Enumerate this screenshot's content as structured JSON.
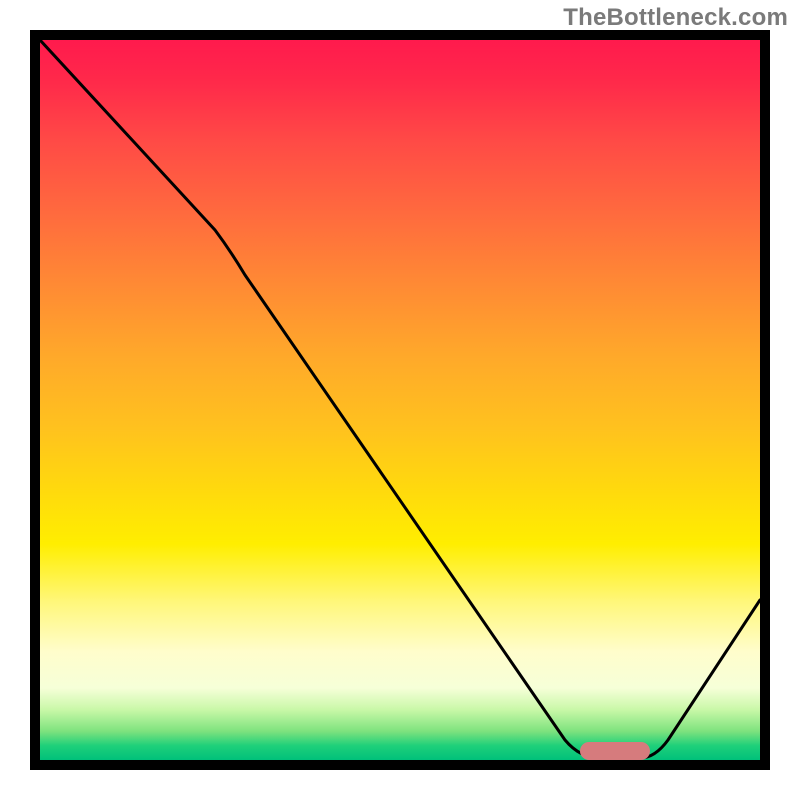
{
  "watermark": "TheBottleneck.com",
  "colors": {
    "top": "#ff1a4d",
    "mid": "#ffee00",
    "bottom": "#00c07a",
    "marker": "#d67b7d",
    "curve": "#000000",
    "border": "#000000"
  },
  "chart_data": {
    "type": "line",
    "title": "",
    "xlabel": "",
    "ylabel": "",
    "xlim": [
      0,
      100
    ],
    "ylim": [
      0,
      100
    ],
    "grid": false,
    "legend": false,
    "annotations": [
      {
        "text": "TheBottleneck.com",
        "position": "top-right"
      }
    ],
    "series": [
      {
        "name": "bottleneck-curve",
        "x": [
          0,
          24,
          76,
          84,
          100
        ],
        "y": [
          100,
          74,
          0,
          0,
          22
        ]
      }
    ],
    "marker": {
      "x_start": 76,
      "x_end": 84,
      "y": 0
    },
    "background_gradient_stops": [
      {
        "pct": 0,
        "color": "#ff1a4d"
      },
      {
        "pct": 70,
        "color": "#ffee00"
      },
      {
        "pct": 90,
        "color": "#f6ffd8"
      },
      {
        "pct": 100,
        "color": "#00c07a"
      }
    ]
  }
}
